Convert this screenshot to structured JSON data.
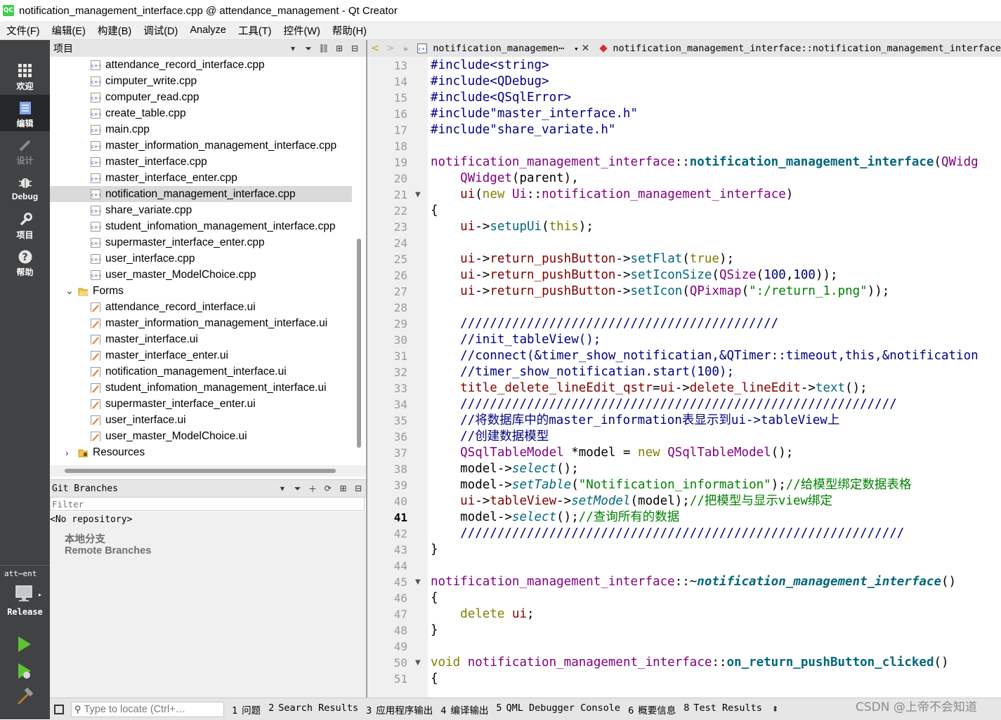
{
  "window": {
    "title": "notification_management_interface.cpp @ attendance_management - Qt Creator",
    "logo_text": "QC"
  },
  "menu": [
    "文件(F)",
    "编辑(E)",
    "构建(B)",
    "调试(D)",
    "Analyze",
    "工具(T)",
    "控件(W)",
    "帮助(H)"
  ],
  "modes": [
    {
      "label": "欢迎",
      "icon": "grid-icon",
      "state": "normal"
    },
    {
      "label": "编辑",
      "icon": "document-icon",
      "state": "active"
    },
    {
      "label": "设计",
      "icon": "pencil-icon",
      "state": "disabled"
    },
    {
      "label": "Debug",
      "icon": "bug-icon",
      "state": "normal"
    },
    {
      "label": "项目",
      "icon": "wrench-icon",
      "state": "normal"
    },
    {
      "label": "帮助",
      "icon": "help-icon",
      "state": "normal"
    }
  ],
  "kit": {
    "project": "att⋯ent",
    "build": "Release"
  },
  "project_pane": {
    "title": "项目",
    "items": [
      {
        "label": "attendance_record_interface.cpp",
        "kind": "cpp",
        "indent": 2
      },
      {
        "label": "cimputer_write.cpp",
        "kind": "cpp",
        "indent": 2
      },
      {
        "label": "computer_read.cpp",
        "kind": "cpp",
        "indent": 2
      },
      {
        "label": "create_table.cpp",
        "kind": "cpp",
        "indent": 2
      },
      {
        "label": "main.cpp",
        "kind": "cpp",
        "indent": 2
      },
      {
        "label": "master_information_management_interface.cpp",
        "kind": "cpp",
        "indent": 2
      },
      {
        "label": "master_interface.cpp",
        "kind": "cpp",
        "indent": 2
      },
      {
        "label": "master_interface_enter.cpp",
        "kind": "cpp",
        "indent": 2
      },
      {
        "label": "notification_management_interface.cpp",
        "kind": "cpp",
        "indent": 2,
        "selected": true
      },
      {
        "label": "share_variate.cpp",
        "kind": "cpp",
        "indent": 2
      },
      {
        "label": "student_infomation_management_interface.cpp",
        "kind": "cpp",
        "indent": 2
      },
      {
        "label": "supermaster_interface_enter.cpp",
        "kind": "cpp",
        "indent": 2
      },
      {
        "label": "user_interface.cpp",
        "kind": "cpp",
        "indent": 2
      },
      {
        "label": "user_master_ModelChoice.cpp",
        "kind": "cpp",
        "indent": 2
      },
      {
        "label": "Forms",
        "kind": "folder-open",
        "indent": 1
      },
      {
        "label": "attendance_record_interface.ui",
        "kind": "ui",
        "indent": 2
      },
      {
        "label": "master_information_management_interface.ui",
        "kind": "ui",
        "indent": 2
      },
      {
        "label": "master_interface.ui",
        "kind": "ui",
        "indent": 2
      },
      {
        "label": "master_interface_enter.ui",
        "kind": "ui",
        "indent": 2
      },
      {
        "label": "notification_management_interface.ui",
        "kind": "ui",
        "indent": 2
      },
      {
        "label": "student_infomation_management_interface.ui",
        "kind": "ui",
        "indent": 2
      },
      {
        "label": "supermaster_interface_enter.ui",
        "kind": "ui",
        "indent": 2
      },
      {
        "label": "user_interface.ui",
        "kind": "ui",
        "indent": 2
      },
      {
        "label": "user_master_ModelChoice.ui",
        "kind": "ui",
        "indent": 2
      },
      {
        "label": "Resources",
        "kind": "folder-closed",
        "indent": 1
      }
    ]
  },
  "git_pane": {
    "title": "Git Branches",
    "filter_placeholder": "Filter",
    "repository": "<No repository>",
    "branches": [
      "本地分支",
      "Remote Branches"
    ]
  },
  "editor": {
    "document": "notification_managemen⋯",
    "symbol": "notification_management_interface::notification_management_interface",
    "first_line": 13,
    "current_line": 41,
    "fold_lines": [
      21,
      45,
      50
    ],
    "lines": [
      [
        [
          "inc",
          "#include<string>"
        ]
      ],
      [
        [
          "inc",
          "#include<QDebug>"
        ]
      ],
      [
        [
          "inc",
          "#include<QSqlError>"
        ]
      ],
      [
        [
          "inc",
          "#include\"master_interface.h\""
        ]
      ],
      [
        [
          "inc",
          "#include\"share_variate.h\""
        ]
      ],
      [],
      [
        [
          "cls",
          "notification_management_interface"
        ],
        [
          "pl",
          "::"
        ],
        [
          "fnb",
          "notification_management_interface"
        ],
        [
          "pl",
          "("
        ],
        [
          "cls",
          "QWidg"
        ]
      ],
      [
        [
          "pl",
          "    "
        ],
        [
          "cls",
          "QWidget"
        ],
        [
          "pl",
          "(parent),"
        ]
      ],
      [
        [
          "pl",
          "    "
        ],
        [
          "mem",
          "ui"
        ],
        [
          "pl",
          "("
        ],
        [
          "kw",
          "new"
        ],
        [
          "pl",
          " "
        ],
        [
          "cls",
          "Ui"
        ],
        [
          "pl",
          "::"
        ],
        [
          "cls",
          "notification_management_interface"
        ],
        [
          "pl",
          ")"
        ]
      ],
      [
        [
          "pl",
          "{"
        ]
      ],
      [
        [
          "pl",
          "    "
        ],
        [
          "mem",
          "ui"
        ],
        [
          "pl",
          "->"
        ],
        [
          "fn",
          "setupUi"
        ],
        [
          "pl",
          "("
        ],
        [
          "kw",
          "this"
        ],
        [
          "pl",
          ");"
        ]
      ],
      [],
      [
        [
          "pl",
          "    "
        ],
        [
          "mem",
          "ui"
        ],
        [
          "pl",
          "->"
        ],
        [
          "mem",
          "return_pushButton"
        ],
        [
          "pl",
          "->"
        ],
        [
          "fn",
          "setFlat"
        ],
        [
          "pl",
          "("
        ],
        [
          "kw",
          "true"
        ],
        [
          "pl",
          ");"
        ]
      ],
      [
        [
          "pl",
          "    "
        ],
        [
          "mem",
          "ui"
        ],
        [
          "pl",
          "->"
        ],
        [
          "mem",
          "return_pushButton"
        ],
        [
          "pl",
          "->"
        ],
        [
          "fn",
          "setIconSize"
        ],
        [
          "pl",
          "("
        ],
        [
          "cls",
          "QSize"
        ],
        [
          "pl",
          "("
        ],
        [
          "num",
          "100"
        ],
        [
          "pl",
          ","
        ],
        [
          "num",
          "100"
        ],
        [
          "pl",
          "));"
        ]
      ],
      [
        [
          "pl",
          "    "
        ],
        [
          "mem",
          "ui"
        ],
        [
          "pl",
          "->"
        ],
        [
          "mem",
          "return_pushButton"
        ],
        [
          "pl",
          "->"
        ],
        [
          "fn",
          "setIcon"
        ],
        [
          "pl",
          "("
        ],
        [
          "cls",
          "QPixmap"
        ],
        [
          "pl",
          "("
        ],
        [
          "str",
          "\":/return_1.png\""
        ],
        [
          "pl",
          "));"
        ]
      ],
      [],
      [
        [
          "pl",
          "    "
        ],
        [
          "cm",
          "///////////////////////////////////////////"
        ]
      ],
      [
        [
          "pl",
          "    "
        ],
        [
          "cm",
          "//init_tableView();"
        ]
      ],
      [
        [
          "pl",
          "    "
        ],
        [
          "cm",
          "//connect(&timer_show_notificatian,&QTimer::timeout,this,&notification"
        ]
      ],
      [
        [
          "pl",
          "    "
        ],
        [
          "cm",
          "//timer_show_notificatian.start(100);"
        ]
      ],
      [
        [
          "pl",
          "    "
        ],
        [
          "mem",
          "title_delete_lineEdit_qstr"
        ],
        [
          "pl",
          "="
        ],
        [
          "mem",
          "ui"
        ],
        [
          "pl",
          "->"
        ],
        [
          "mem",
          "delete_lineEdit"
        ],
        [
          "pl",
          "->"
        ],
        [
          "fn",
          "text"
        ],
        [
          "pl",
          "();"
        ]
      ],
      [
        [
          "pl",
          "    "
        ],
        [
          "cm",
          "///////////////////////////////////////////////////////////"
        ]
      ],
      [
        [
          "pl",
          "    "
        ],
        [
          "cm",
          "//将数据库中的master_information表显示到ui->tableView上"
        ]
      ],
      [
        [
          "pl",
          "    "
        ],
        [
          "cm",
          "//创建数据模型"
        ]
      ],
      [
        [
          "pl",
          "    "
        ],
        [
          "cls",
          "QSqlTableModel"
        ],
        [
          "pl",
          " *model = "
        ],
        [
          "kw",
          "new"
        ],
        [
          "pl",
          " "
        ],
        [
          "cls",
          "QSqlTableModel"
        ],
        [
          "pl",
          "();"
        ]
      ],
      [
        [
          "pl",
          "    model->"
        ],
        [
          "fni",
          "select"
        ],
        [
          "pl",
          "();"
        ]
      ],
      [
        [
          "pl",
          "    model->"
        ],
        [
          "fni",
          "setTable"
        ],
        [
          "pl",
          "("
        ],
        [
          "str",
          "\"Notification_information\""
        ],
        [
          "pl",
          ");"
        ],
        [
          "cmg",
          "//给模型绑定数据表格"
        ]
      ],
      [
        [
          "pl",
          "    "
        ],
        [
          "mem",
          "ui"
        ],
        [
          "pl",
          "->"
        ],
        [
          "mem",
          "tableView"
        ],
        [
          "pl",
          "->"
        ],
        [
          "fni",
          "setModel"
        ],
        [
          "pl",
          "(model);"
        ],
        [
          "cmg",
          "//把模型与显示view绑定"
        ]
      ],
      [
        [
          "pl",
          "    model->"
        ],
        [
          "fni",
          "select"
        ],
        [
          "pl",
          "();"
        ],
        [
          "cmg",
          "//查询所有的数据"
        ]
      ],
      [
        [
          "pl",
          "    "
        ],
        [
          "cm",
          "////////////////////////////////////////////////////////////"
        ]
      ],
      [
        [
          "pl",
          "}"
        ]
      ],
      [],
      [
        [
          "cls",
          "notification_management_interface"
        ],
        [
          "pl",
          "::~"
        ],
        [
          "fnbi",
          "notification_management_interface"
        ],
        [
          "pl",
          "()"
        ]
      ],
      [
        [
          "pl",
          "{"
        ]
      ],
      [
        [
          "pl",
          "    "
        ],
        [
          "kw",
          "delete"
        ],
        [
          "pl",
          " "
        ],
        [
          "mem",
          "ui"
        ],
        [
          "pl",
          ";"
        ]
      ],
      [
        [
          "pl",
          "}"
        ]
      ],
      [],
      [
        [
          "kw",
          "void"
        ],
        [
          "pl",
          " "
        ],
        [
          "cls",
          "notification_management_interface"
        ],
        [
          "pl",
          "::"
        ],
        [
          "fnb",
          "on_return_pushButton_clicked"
        ],
        [
          "pl",
          "()"
        ]
      ],
      [
        [
          "pl",
          "{"
        ]
      ]
    ]
  },
  "statusbar": {
    "locator_placeholder": "Type to locate (Ctrl+…",
    "tabs": [
      {
        "num": "1",
        "label": "问题"
      },
      {
        "num": "2",
        "label": "Search Results"
      },
      {
        "num": "3",
        "label": "应用程序输出"
      },
      {
        "num": "4",
        "label": "编译输出"
      },
      {
        "num": "5",
        "label": "QML Debugger Console"
      },
      {
        "num": "6",
        "label": "概要信息"
      },
      {
        "num": "8",
        "label": "Test Results"
      }
    ]
  },
  "watermark": "CSDN @上帝不会知道"
}
